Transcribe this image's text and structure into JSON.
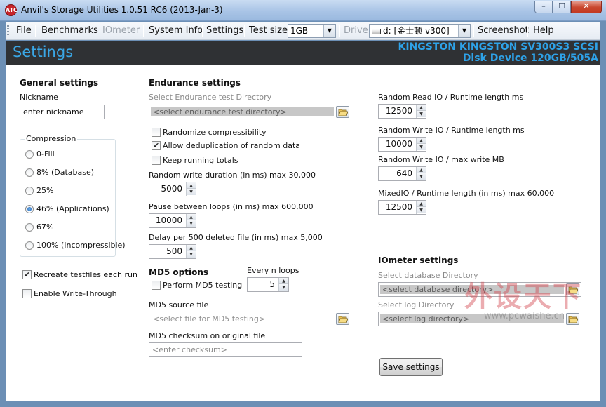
{
  "window": {
    "title": "Anvil's Storage Utilities 1.0.51 RC6 (2013-Jan-3)",
    "app_icon_text": "ATC",
    "minimize": "–",
    "maximize": "☐",
    "close": "✕"
  },
  "menu": {
    "file": "File",
    "benchmarks": "Benchmarks",
    "iometer": "IOmeter",
    "system_info": "System Info",
    "settings": "Settings",
    "test_size_label": "Test size",
    "test_size_value": "1GB",
    "drive_label": "Drive",
    "drive_value": "d: [金士顿 v300]",
    "screenshot": "Screenshot",
    "help": "Help"
  },
  "header": {
    "title": "Settings",
    "disk_line1": "KINGSTON KINGSTON SV300S3 SCSI",
    "disk_line2": "Disk Device 120GB/505A"
  },
  "general": {
    "heading": "General settings",
    "nickname_label": "Nickname",
    "nickname_value": "enter nickname",
    "compression_legend": "Compression",
    "compression_options": [
      "0-Fill",
      "8% (Database)",
      "25%",
      "46% (Applications)",
      "67%",
      "100% (Incompressible)"
    ],
    "compression_selected": "46% (Applications)",
    "recreate_label": "Recreate testfiles each run",
    "recreate_checked": true,
    "write_through_label": "Enable Write-Through",
    "write_through_checked": false
  },
  "endurance": {
    "heading": "Endurance settings",
    "dir_label": "Select Endurance test Directory",
    "dir_placeholder": "<select endurance test directory>",
    "randomize_label": "Randomize compressibility",
    "randomize_checked": false,
    "dedup_label": "Allow deduplication of random data",
    "dedup_checked": true,
    "running_totals_label": "Keep running totals",
    "running_totals_checked": false,
    "random_write_label": "Random write duration (in ms) max 30,000",
    "random_write_value": "5000",
    "pause_label": "Pause between loops (in ms) max 600,000",
    "pause_value": "10000",
    "delay_label": "Delay per 500 deleted file (in ms) max 5,000",
    "delay_value": "500"
  },
  "md5": {
    "heading": "MD5 options",
    "every_n_label": "Every n loops",
    "every_n_value": "5",
    "perform_label": "Perform MD5 testing",
    "perform_checked": false,
    "source_label": "MD5 source file",
    "source_placeholder": "<select file for MD5 testing>",
    "checksum_label": "MD5 checksum on original file",
    "checksum_placeholder": "<enter checksum>"
  },
  "runtime": {
    "random_read_label": "Random Read IO / Runtime length ms",
    "random_read_value": "12500",
    "random_write_label": "Random Write IO / Runtime length ms",
    "random_write_value": "10000",
    "max_write_label": "Random Write IO / max write MB",
    "max_write_value": "640",
    "mixed_label": "MixedIO / Runtime length (in ms) max 60,000",
    "mixed_value": "12500"
  },
  "iometer": {
    "heading": "IOmeter settings",
    "db_label": "Select database Directory",
    "db_placeholder": "<select database directory>",
    "log_label": "Select log Directory",
    "log_placeholder": "<select log directory>"
  },
  "save_button": "Save settings",
  "watermark": {
    "text": "外设天下",
    "url": "www.pcwaishe.cn"
  }
}
